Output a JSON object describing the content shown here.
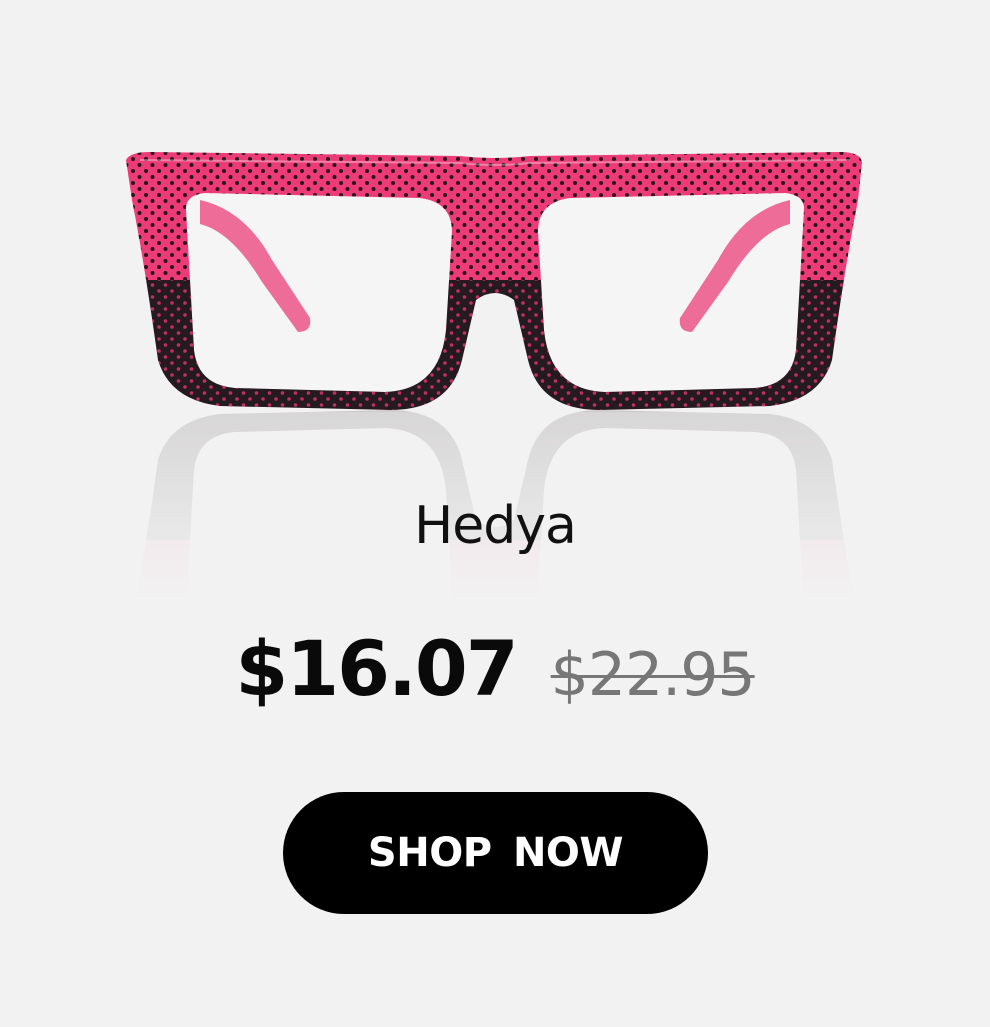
{
  "product": {
    "name": "Hedya",
    "price_current": "$16.07",
    "price_original": "$22.95",
    "image_icon": "eyeglasses-icon",
    "frame_colors": {
      "top": "#ec3b77",
      "bottom": "#241a1f",
      "dot_dark": "#2a141c",
      "dot_pink": "#c12f63",
      "temple": "#e93d76"
    }
  },
  "cta": {
    "label": "SHOP NOW",
    "background": "#000000",
    "text_color": "#ffffff"
  },
  "page": {
    "background": "#f2f2f2"
  }
}
